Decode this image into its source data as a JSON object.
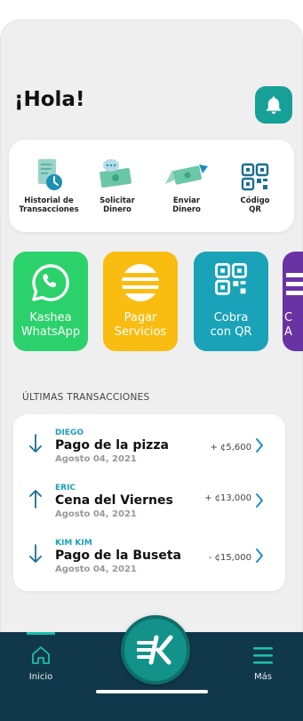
{
  "header": {
    "greeting": "¡Hola!"
  },
  "quick_actions": [
    {
      "label": "Historial de\nTransacciones",
      "icon": "history-icon"
    },
    {
      "label": "Solicitar\nDinero",
      "icon": "request-money-icon"
    },
    {
      "label": "Enviar\nDinero",
      "icon": "send-money-icon"
    },
    {
      "label": "Código\nQR",
      "icon": "qr-code-icon"
    }
  ],
  "tiles": [
    {
      "label": "Kashea\nWhatsApp",
      "color": "#2bd26b",
      "icon": "whatsapp-icon"
    },
    {
      "label": "Pagar\nServicios",
      "color": "#f9bd12",
      "icon": "services-icon"
    },
    {
      "label": "Cobra\ncon QR",
      "color": "#1aa3b8",
      "icon": "qr-code-icon"
    },
    {
      "label": "C\nA",
      "color": "#6a33a3",
      "icon": "partial-icon"
    }
  ],
  "transactions": {
    "section_title": "ÚLTIMAS TRANSACCIONES",
    "items": [
      {
        "name": "DIEGO",
        "title": "Pago de la pizza",
        "date": "Agosto 04, 2021",
        "amount": "+ ¢5,600",
        "direction": "down"
      },
      {
        "name": "ERIC",
        "title": "Cena del Viernes",
        "date": "Agosto 04, 2021",
        "amount": "+ ¢13,000",
        "direction": "up"
      },
      {
        "name": "KIM KIM",
        "title": "Pago de la Buseta",
        "date": "Agosto 04, 2021",
        "amount": "- ¢15,000",
        "direction": "down"
      }
    ]
  },
  "nav": {
    "home_label": "Inicio",
    "more_label": "Más"
  },
  "colors": {
    "accent": "#17a097",
    "link": "#1aa0b8",
    "nav_bg": "#11384a"
  }
}
